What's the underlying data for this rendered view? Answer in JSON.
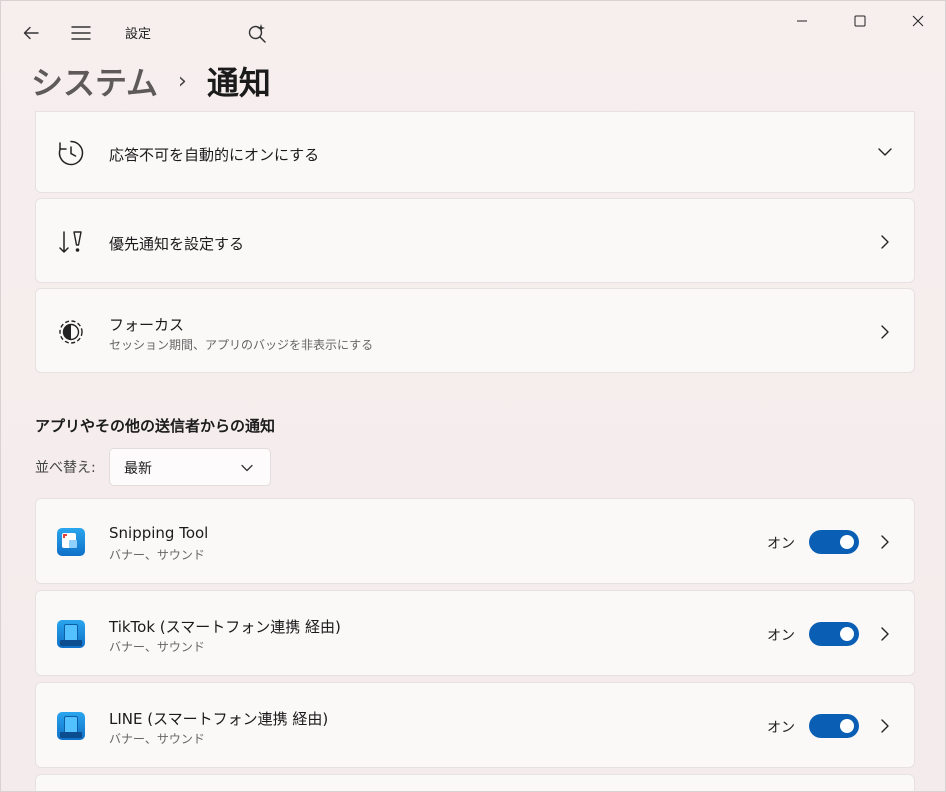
{
  "window": {
    "app_title": "設定",
    "back_icon": "back-arrow-icon",
    "menu_icon": "hamburger-menu-icon",
    "search_icon": "search-sparkle-icon"
  },
  "breadcrumb": {
    "parent": "システム",
    "separator": "›",
    "current": "通知"
  },
  "settings": [
    {
      "title": "応答不可を自動的にオンにする",
      "icon": "clock-icon",
      "action": "chevron-down-icon"
    },
    {
      "title": "優先通知を設定する",
      "icon": "priority-icon",
      "action": "chevron-right-icon"
    },
    {
      "title": "フォーカス",
      "subtitle": "セッション期間、アプリのバッジを非表示にする",
      "icon": "focus-icon",
      "action": "chevron-right-icon"
    }
  ],
  "apps_section": {
    "heading": "アプリやその他の送信者からの通知",
    "sort_label": "並べ替え:",
    "sort_value": "最新"
  },
  "apps": [
    {
      "name": "Snipping Tool",
      "subtitle": "バナー、サウンド",
      "toggle_label": "オン",
      "enabled": true,
      "icon": "snipping-tool-icon"
    },
    {
      "name": "TikTok (スマートフォン連携 経由)",
      "subtitle": "バナー、サウンド",
      "toggle_label": "オン",
      "enabled": true,
      "icon": "phone-link-icon"
    },
    {
      "name": "LINE (スマートフォン連携 経由)",
      "subtitle": "バナー、サウンド",
      "toggle_label": "オン",
      "enabled": true,
      "icon": "phone-link-icon"
    }
  ],
  "colors": {
    "accent": "#0a5fb4",
    "background": "#f6eded",
    "card": "#fbf8f8"
  }
}
